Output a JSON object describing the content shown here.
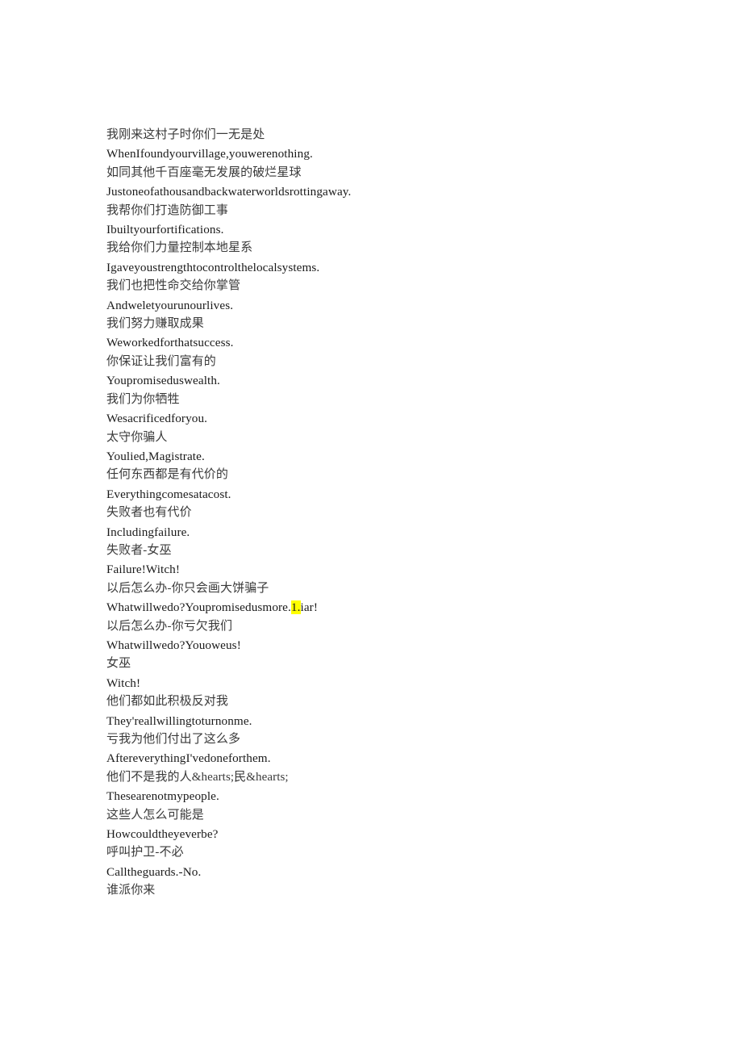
{
  "document": {
    "background_color": "#ffffff",
    "text_color_chinese": "#3a3a3a",
    "text_color_english": "#1a1a1a",
    "highlight_color": "#ffff00",
    "lines": [
      {
        "lang": "zh",
        "text": "我刚来这村子时你们一无是处"
      },
      {
        "lang": "en",
        "text": "WhenIfoundyourvillage,youwerenothing."
      },
      {
        "lang": "zh",
        "text": "如同其他千百座毫无发展的破烂星球"
      },
      {
        "lang": "en",
        "text": "Justoneofathousandbackwaterworldsrottingaway."
      },
      {
        "lang": "zh",
        "text": "我帮你们打造防御工事"
      },
      {
        "lang": "en",
        "text": "Ibuiltyourfortifications."
      },
      {
        "lang": "zh",
        "text": "我给你们力量控制本地星系"
      },
      {
        "lang": "en",
        "text": "Igaveyoustrengthtocontrolthelocalsystems."
      },
      {
        "lang": "zh",
        "text": "我们也把性命交给你掌管"
      },
      {
        "lang": "en",
        "text": "Andweletyourunourlives."
      },
      {
        "lang": "zh",
        "text": "我们努力赚取成果"
      },
      {
        "lang": "en",
        "text": "Weworkedforthatsuccess."
      },
      {
        "lang": "zh",
        "text": "你保证让我们富有的"
      },
      {
        "lang": "en",
        "text": "Youpromiseduswealth."
      },
      {
        "lang": "zh",
        "text": "我们为你牺牲"
      },
      {
        "lang": "en",
        "text": "Wesacrificedforyou."
      },
      {
        "lang": "zh",
        "text": "太守你骗人"
      },
      {
        "lang": "en",
        "text": "Youlied,Magistrate."
      },
      {
        "lang": "zh",
        "text": "任何东西都是有代价的"
      },
      {
        "lang": "en",
        "text": "Everythingcomesatacost."
      },
      {
        "lang": "zh",
        "text": "失败者也有代价"
      },
      {
        "lang": "en",
        "text": "Includingfailure."
      },
      {
        "lang": "zh",
        "text": "失败者-女巫"
      },
      {
        "lang": "en",
        "text": "Failure!Witch!"
      },
      {
        "lang": "zh",
        "text": "以后怎么办-你只会画大饼骗子"
      },
      {
        "lang": "en",
        "segments": [
          {
            "text": "Whatwillwedo?Youpromisedusmore.",
            "highlight": false
          },
          {
            "text": "1.",
            "highlight": true
          },
          {
            "text": "iar!",
            "highlight": false
          }
        ]
      },
      {
        "lang": "zh",
        "text": "以后怎么办-你亏欠我们"
      },
      {
        "lang": "en",
        "text": "Whatwillwedo?Youoweus!"
      },
      {
        "lang": "zh",
        "text": "女巫"
      },
      {
        "lang": "en",
        "text": "Witch!"
      },
      {
        "lang": "zh",
        "text": "他们都如此积极反对我"
      },
      {
        "lang": "en",
        "text": "They'reallwillingtoturnonme."
      },
      {
        "lang": "zh",
        "text": "亏我为他们付出了这么多"
      },
      {
        "lang": "en",
        "text": "AftereverythingI'vedoneforthem."
      },
      {
        "lang": "zh",
        "text": "他们不是我的人&hearts;民&hearts;"
      },
      {
        "lang": "en",
        "text": "Thesearenotmypeople."
      },
      {
        "lang": "zh",
        "text": "这些人怎么可能是"
      },
      {
        "lang": "en",
        "text": "Howcouldtheyeverbe?"
      },
      {
        "lang": "zh",
        "text": "呼叫护卫-不必"
      },
      {
        "lang": "en",
        "text": "Calltheguards.-No."
      },
      {
        "lang": "zh",
        "text": "谁派你来"
      }
    ]
  }
}
